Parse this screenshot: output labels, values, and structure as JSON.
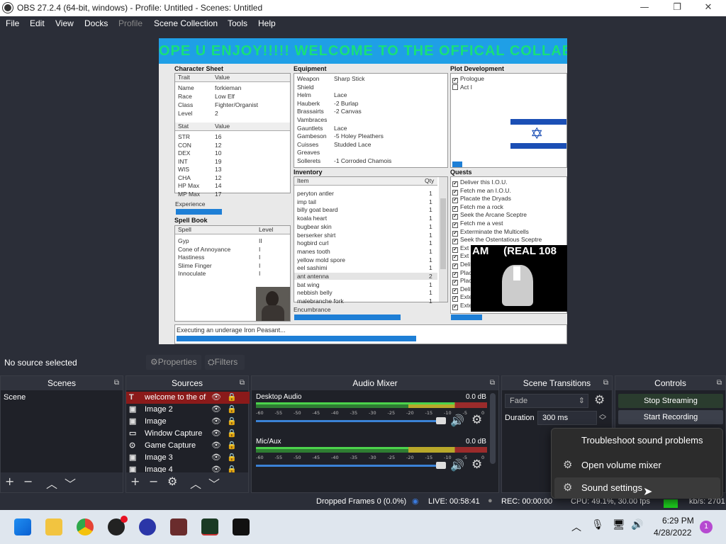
{
  "window": {
    "title": "OBS 27.2.4 (64-bit, windows) - Profile: Untitled - Scenes: Untitled",
    "minimize": "—",
    "maximize": "❐",
    "close": "✕"
  },
  "menu": [
    "File",
    "Edit",
    "View",
    "Docks",
    "Profile",
    "Scene Collection",
    "Tools",
    "Help"
  ],
  "canvas": {
    "banner": "OPE U ENJOY!!!!! WELCOME TO THE OFFICAL COLLAB",
    "character_sheet": {
      "title": "Character Sheet",
      "cols": [
        "Trait",
        "Value"
      ],
      "traits": [
        [
          "Name",
          "forkieman"
        ],
        [
          "Race",
          "Low Elf"
        ],
        [
          "Class",
          "Fighter/Organist"
        ],
        [
          "Level",
          "2"
        ]
      ],
      "stat_cols": [
        "Stat",
        "Value"
      ],
      "stats": [
        [
          "STR",
          "16"
        ],
        [
          "CON",
          "12"
        ],
        [
          "DEX",
          "10"
        ],
        [
          "INT",
          "19"
        ],
        [
          "WIS",
          "13"
        ],
        [
          "CHA",
          "12"
        ],
        [
          "HP Max",
          "14"
        ],
        [
          "MP Max",
          "17"
        ]
      ],
      "experience": "Experience"
    },
    "spell_book": {
      "title": "Spell Book",
      "cols": [
        "Spell",
        "Level"
      ],
      "spells": [
        [
          "Gyp",
          "II"
        ],
        [
          "Cone of Annoyance",
          "I"
        ],
        [
          "Hastiness",
          "I"
        ],
        [
          "Slime Finger",
          "I"
        ],
        [
          "Innoculate",
          "I"
        ]
      ]
    },
    "equipment": {
      "title": "Equipment",
      "items": [
        [
          "Weapon",
          "Sharp Stick"
        ],
        [
          "Shield",
          ""
        ],
        [
          "Helm",
          "Lace"
        ],
        [
          "Hauberk",
          "-2 Burlap"
        ],
        [
          "Brassairts",
          "-2 Canvas"
        ],
        [
          "Vambraces",
          ""
        ],
        [
          "Gauntlets",
          "Lace"
        ],
        [
          "Gambeson",
          "-5 Holey Pleathers"
        ],
        [
          "Cuisses",
          "Studded Lace"
        ],
        [
          "Greaves",
          ""
        ],
        [
          "Sollerets",
          "-1 Corroded Chamois"
        ]
      ]
    },
    "inventory": {
      "title": "Inventory",
      "cols": [
        "Item",
        "Qty"
      ],
      "items": [
        [
          "peryton antler",
          "1"
        ],
        [
          "imp tail",
          "1"
        ],
        [
          "billy goat beard",
          "1"
        ],
        [
          "koala heart",
          "1"
        ],
        [
          "bugbear skin",
          "1"
        ],
        [
          "berserker shirt",
          "1"
        ],
        [
          "hogbird curl",
          "1"
        ],
        [
          "manes tooth",
          "1"
        ],
        [
          "yellow mold spore",
          "1"
        ],
        [
          "eel sashimi",
          "1"
        ],
        [
          "ant antenna",
          "2"
        ],
        [
          "bat wing",
          "1"
        ],
        [
          "nebbish belly",
          "1"
        ],
        [
          "malebranche fork",
          "1"
        ]
      ],
      "encumbrance": "Encumbrance"
    },
    "plot": {
      "title": "Plot Development",
      "items": [
        [
          "✔",
          "Prologue"
        ],
        [
          "",
          "Act I"
        ]
      ]
    },
    "quests": {
      "title": "Quests",
      "items": [
        "Deliver this I.O.U.",
        "Fetch me an I.O.U.",
        "Placate the Dryads",
        "Fetch me a rock",
        "Seek the Arcane Sceptre",
        "Fetch me a vest",
        "Exterminate the Multicells",
        "Seek the Ostentatious Sceptre",
        "Ext",
        "Ext",
        "Deliv",
        "Plac",
        "Plac",
        "Deliv",
        "Exte",
        "Exte"
      ]
    },
    "overlay_text": "AM     (REAL 108",
    "status": "Executing an underage Iron Peasant..."
  },
  "source_bar": {
    "no_source": "No source selected",
    "properties": "Properties",
    "filters": "Filters"
  },
  "scenes": {
    "title": "Scenes",
    "items": [
      "Scene"
    ]
  },
  "sources": {
    "title": "Sources",
    "items": [
      {
        "icon": "text-icon",
        "glyph": "T",
        "label": "welcome to the of"
      },
      {
        "icon": "image-icon",
        "glyph": "▣",
        "label": "Image 2"
      },
      {
        "icon": "image-icon",
        "glyph": "▣",
        "label": "Image"
      },
      {
        "icon": "window-capture-icon",
        "glyph": "▭",
        "label": "Window Capture"
      },
      {
        "icon": "game-capture-icon",
        "glyph": "⊙",
        "label": "Game Capture"
      },
      {
        "icon": "image-icon",
        "glyph": "▣",
        "label": "Image 3"
      },
      {
        "icon": "image-icon",
        "glyph": "▣",
        "label": "Image 4"
      }
    ]
  },
  "mixer": {
    "title": "Audio Mixer",
    "channels": [
      {
        "name": "Desktop Audio",
        "db": "0.0 dB"
      },
      {
        "name": "Mic/Aux",
        "db": "0.0 dB"
      }
    ],
    "scale": [
      "-60",
      "-55",
      "-50",
      "-45",
      "-40",
      "-35",
      "-30",
      "-25",
      "-20",
      "-15",
      "-10",
      "-5",
      "0"
    ]
  },
  "transitions": {
    "title": "Scene Transitions",
    "type": "Fade",
    "duration_label": "Duration",
    "duration": "300 ms"
  },
  "controls": {
    "title": "Controls",
    "stop_streaming": "Stop Streaming",
    "start_recording": "Start Recording"
  },
  "popup": {
    "items": [
      "Troubleshoot sound problems",
      "Open volume mixer",
      "Sound settings"
    ]
  },
  "status": {
    "dropped": "Dropped Frames 0 (0.0%)",
    "live": "LIVE: 00:58:41",
    "rec": "REC: 00:00:00",
    "cpu": "CPU: 49.1%, 30.00 fps",
    "kbps": "kb/s: 2701"
  },
  "taskbar": {
    "time": "6:29 PM",
    "date": "4/28/2022",
    "notif": "1"
  },
  "colors": {
    "accent": "#1e7fd6",
    "panel_bg": "#1f2128",
    "app_bg": "#2b2e38",
    "source_selected": "#8b1a1a"
  }
}
